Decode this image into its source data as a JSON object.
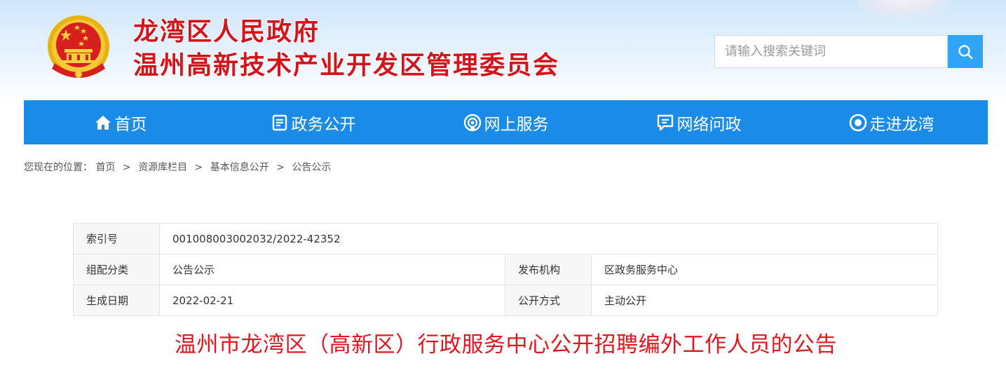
{
  "header": {
    "title_line1": "龙湾区人民政府",
    "title_line2": "温州高新技术产业开发区管理委员会",
    "emblem_icon": "national-emblem-icon"
  },
  "search": {
    "placeholder": "请输入搜索关键词",
    "button_icon": "search-icon"
  },
  "nav": {
    "items": [
      {
        "label": "首页",
        "icon": "home-icon"
      },
      {
        "label": "政务公开",
        "icon": "document-icon"
      },
      {
        "label": "网上服务",
        "icon": "service-icon"
      },
      {
        "label": "网络问政",
        "icon": "chat-icon"
      },
      {
        "label": "走进龙湾",
        "icon": "eye-icon"
      }
    ]
  },
  "breadcrumb": {
    "prefix": "您现在的位置：",
    "items": [
      "首页",
      "资源库栏目",
      "基本信息公开",
      "公告公示"
    ],
    "separator": ">"
  },
  "info": {
    "index_label": "索引号",
    "index_value": "001008003002032/2022-42352",
    "category_label": "组配分类",
    "category_value": "公告公示",
    "publisher_label": "发布机构",
    "publisher_value": "区政务服务中心",
    "date_label": "生成日期",
    "date_value": "2022-02-21",
    "method_label": "公开方式",
    "method_value": "主动公开"
  },
  "article": {
    "title": "温州市龙湾区（高新区）行政服务中心公开招聘编外工作人员的公告"
  },
  "colors": {
    "brand_red": "#d3141a",
    "nav_blue": "#1a8ce8",
    "search_blue": "#2fa3f4",
    "title_red": "#e0181e"
  }
}
